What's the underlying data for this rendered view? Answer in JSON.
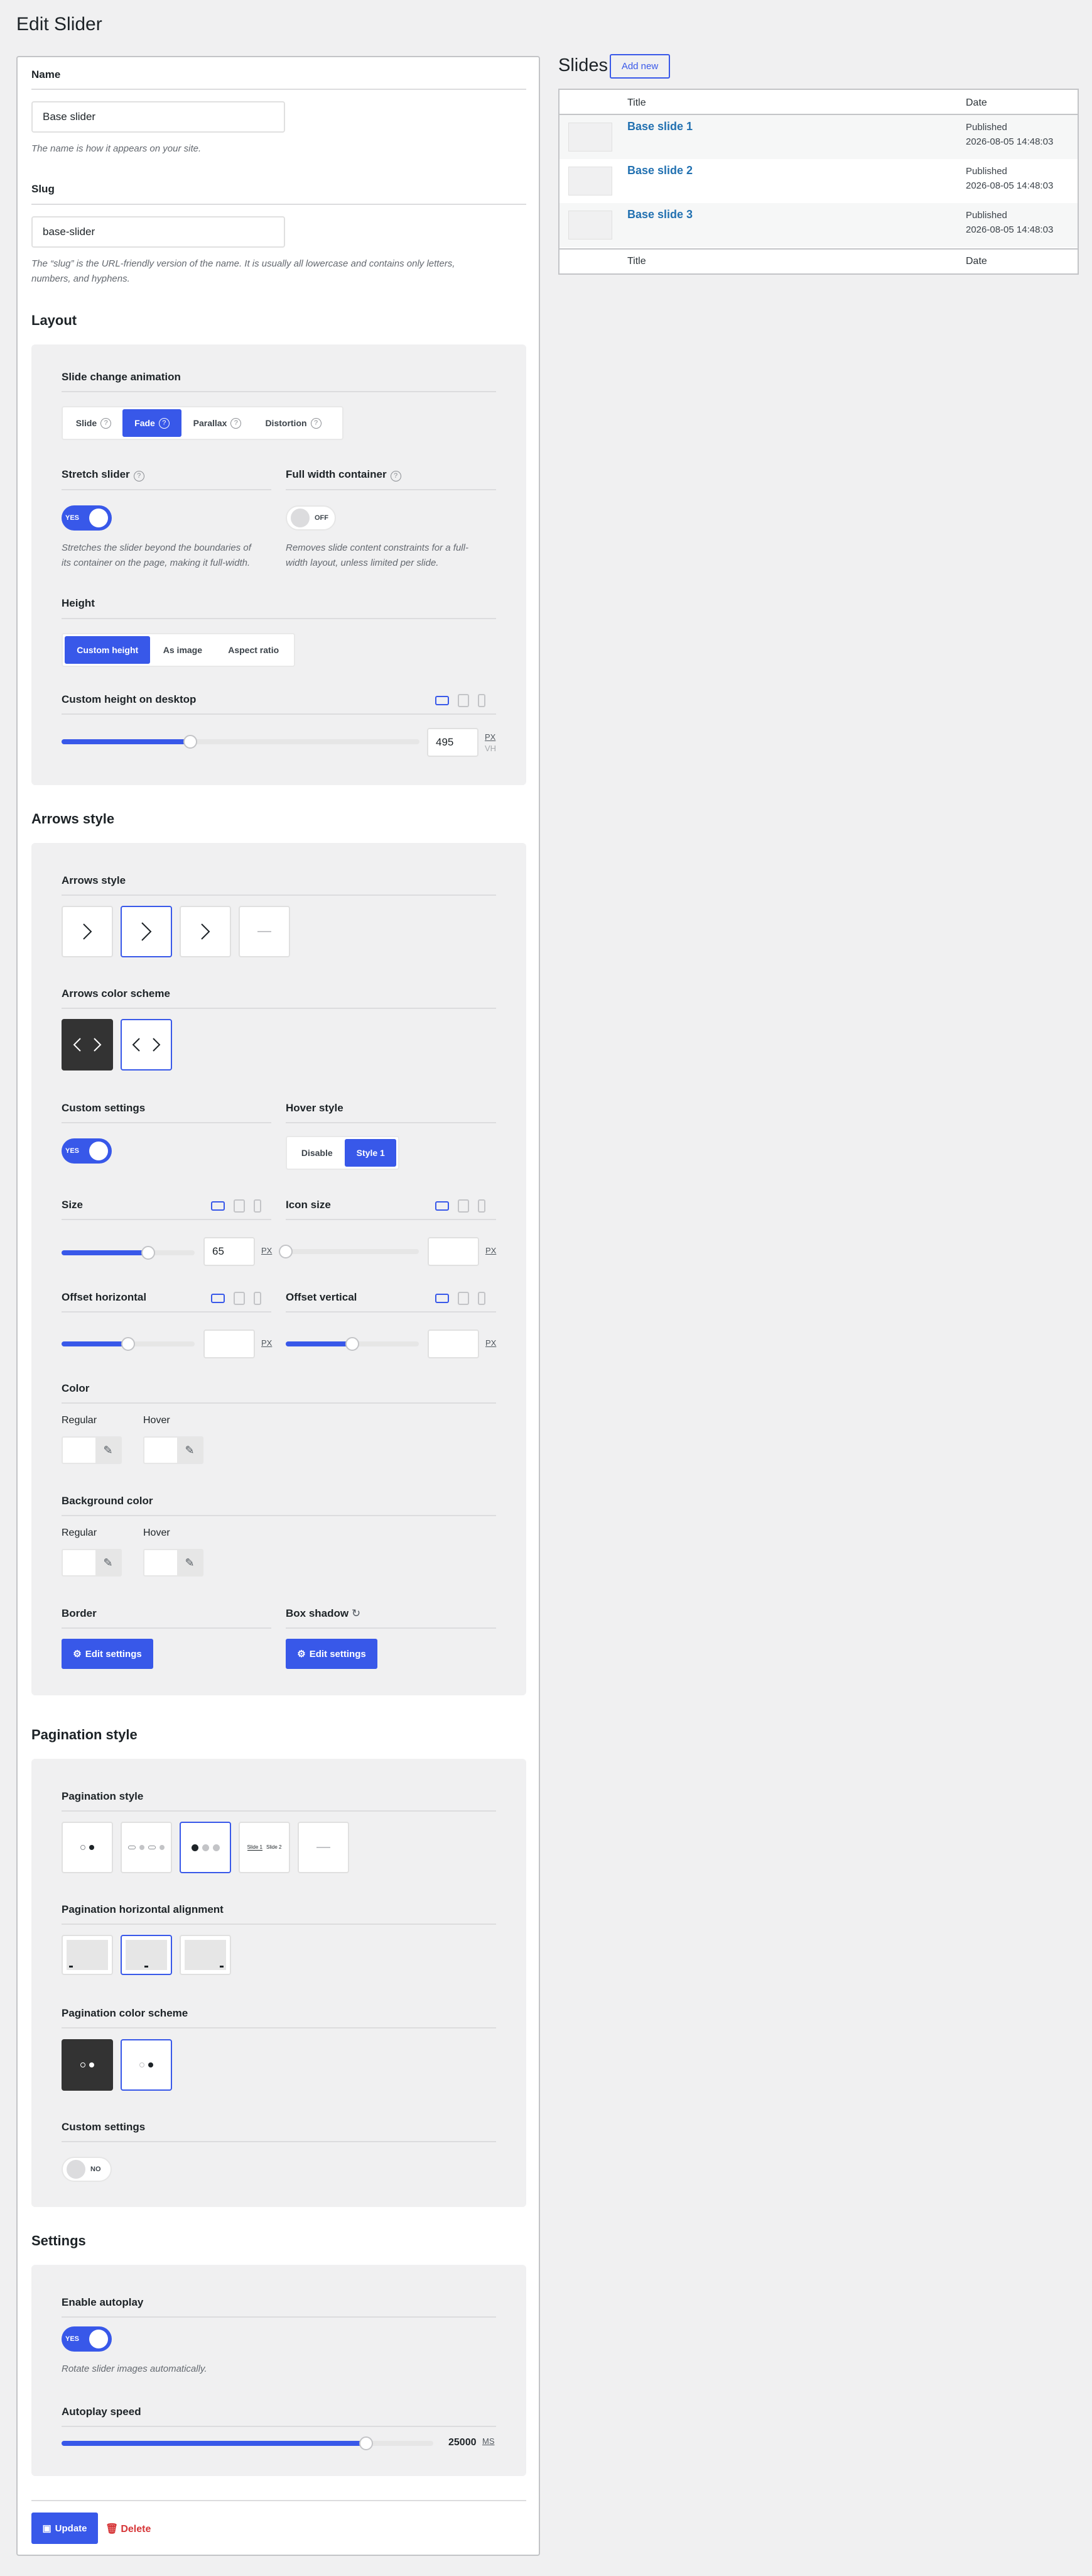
{
  "page_title": "Edit Slider",
  "name": {
    "label": "Name",
    "value": "Base slider",
    "help": "The name is how it appears on your site."
  },
  "slug": {
    "label": "Slug",
    "value": "base-slider",
    "help_line1": "The “slug” is the URL-friendly version of the name. It is usually all lowercase and contains only letters,",
    "help_line2": "numbers, and hyphens."
  },
  "layout": {
    "title": "Layout",
    "animation_label": "Slide change animation",
    "animations": [
      "Slide",
      "Fade",
      "Parallax",
      "Distortion"
    ],
    "animation_selected": "Fade",
    "stretch_label": "Stretch slider",
    "stretch_toggle": "YES",
    "stretch_help_1": "Stretches the slider beyond the boundaries of",
    "stretch_help_2": "its container on the page, making it full-width.",
    "fullwidth_label": "Full width container",
    "fullwidth_toggle": "OFF",
    "fullwidth_help_1": "Removes slide content constraints for a full-",
    "fullwidth_help_2": "width layout, unless limited per slide.",
    "height_label": "Height",
    "height_options": [
      "Custom height",
      "As image",
      "Aspect ratio"
    ],
    "height_selected": "Custom height",
    "custom_height_label": "Custom height on desktop",
    "custom_height_value": "495",
    "custom_height_fraction": 0.36,
    "unit_px": "PX",
    "unit_vh": "VH"
  },
  "arrows": {
    "title": "Arrows style",
    "style_label": "Arrows style",
    "color_scheme_label": "Arrows color scheme",
    "custom_label": "Custom settings",
    "custom_toggle": "YES",
    "hover_label": "Hover style",
    "hover_options": [
      "Disable",
      "Style 1"
    ],
    "hover_selected": "Style 1",
    "size_label": "Size",
    "size_value": "65",
    "size_fraction": 0.65,
    "icon_size_label": "Icon size",
    "icon_size_fraction": 0.0,
    "offset_h_label": "Offset horizontal",
    "offset_h_fraction": 0.5,
    "offset_v_label": "Offset vertical",
    "offset_v_fraction": 0.5,
    "unit_px": "PX",
    "color_label": "Color",
    "bg_color_label": "Background color",
    "regular": "Regular",
    "hover": "Hover",
    "border_label": "Border",
    "shadow_label": "Box shadow",
    "edit_settings": "Edit settings"
  },
  "pagination": {
    "title": "Pagination style",
    "style_label": "Pagination style",
    "slide_text_1": "Slide 1",
    "slide_text_2": "Slide 2",
    "align_label": "Pagination horizontal alignment",
    "color_scheme_label": "Pagination color scheme",
    "custom_label": "Custom settings",
    "custom_toggle": "NO"
  },
  "settings": {
    "title": "Settings",
    "autoplay_label": "Enable autoplay",
    "autoplay_toggle": "YES",
    "autoplay_help": "Rotate slider images automatically.",
    "speed_label": "Autoplay speed",
    "speed_value": "25000",
    "speed_fraction": 0.82,
    "speed_unit": "MS"
  },
  "actions": {
    "update": "Update",
    "delete": "Delete"
  },
  "slides": {
    "title": "Slides",
    "add_new": "Add new",
    "col_title": "Title",
    "col_date": "Date",
    "rows": [
      {
        "title": "Base slide 1",
        "status": "Published",
        "date": "2026-08-05 14:48:03"
      },
      {
        "title": "Base slide 2",
        "status": "Published",
        "date": "2026-08-05 14:48:03"
      },
      {
        "title": "Base slide 3",
        "status": "Published",
        "date": "2026-08-05 14:48:03"
      }
    ]
  },
  "colors": {
    "accent": "#3858e9",
    "link": "#2271b1",
    "danger": "#d63638",
    "dark": "#333333"
  }
}
